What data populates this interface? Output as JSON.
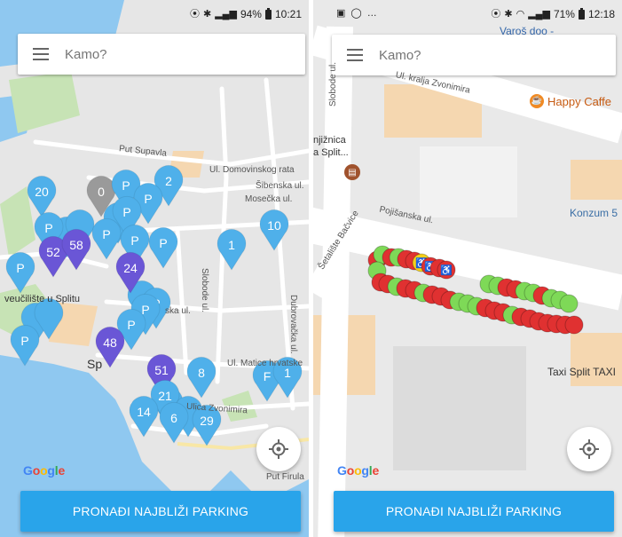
{
  "colors": {
    "accent": "#29a4ea",
    "pin_blue": "#4fb0ea",
    "pin_purple": "#6a56d6",
    "pin_gray": "#9a9a9a",
    "spot_free": "#7ed957",
    "spot_taken": "#e03131",
    "spot_disabled": "#f4cf1a"
  },
  "screen1": {
    "status": {
      "battery": "94%",
      "time": "10:21"
    },
    "search": {
      "placeholder": "Kamo?"
    },
    "map_labels": {
      "put_supavla": "Put Supavla",
      "domovinskog": "Ul. Domovinskog rata",
      "sibenska": "Šibenska ul.",
      "moseceka": "Mosečka ul.",
      "sveuciliste": "veučilište u Splitu",
      "slobode": "Slobode ul.",
      "dubrovacka": "Dubrovačka ul.",
      "matice": "Ul. Matice hrvatske",
      "zvonimira": "Ulica Zvonimira",
      "put_firula": "Put Firula",
      "split": "Sp",
      "ska_ul": "ska ul."
    },
    "pins": [
      "20",
      "0",
      "P",
      "2",
      "P",
      "P",
      "P",
      "P",
      "P",
      "P",
      "10",
      "52",
      "58",
      "P",
      "1",
      "24",
      "P",
      "P",
      "P",
      "P",
      "48",
      "51",
      "8",
      "F",
      "1",
      "21",
      "14",
      "6",
      "29"
    ],
    "google_logo": "Google",
    "button_label": "PRONAĐI NAJBLIŽI PARKING"
  },
  "screen2": {
    "status": {
      "battery": "71%",
      "time": "12:18",
      "overlay_text": "Varoš doo -"
    },
    "search": {
      "placeholder": "Kamo?"
    },
    "map_labels": {
      "slobode": "Slobode ul.",
      "kralja": "Ul. kralja Zvonimira",
      "knjiznica": "njižnica",
      "split": "a Split...",
      "pojisanska": "Pojišanska ul.",
      "setaliste": "Šetalište Bačvice",
      "konzum": "Konzum 5",
      "taxi": "Taxi Split TAXI"
    },
    "poi_cafe": "Happy Caffe",
    "google_logo": "Google",
    "button_label": "PRONAĐI NAJBLIŽI PARKING"
  }
}
